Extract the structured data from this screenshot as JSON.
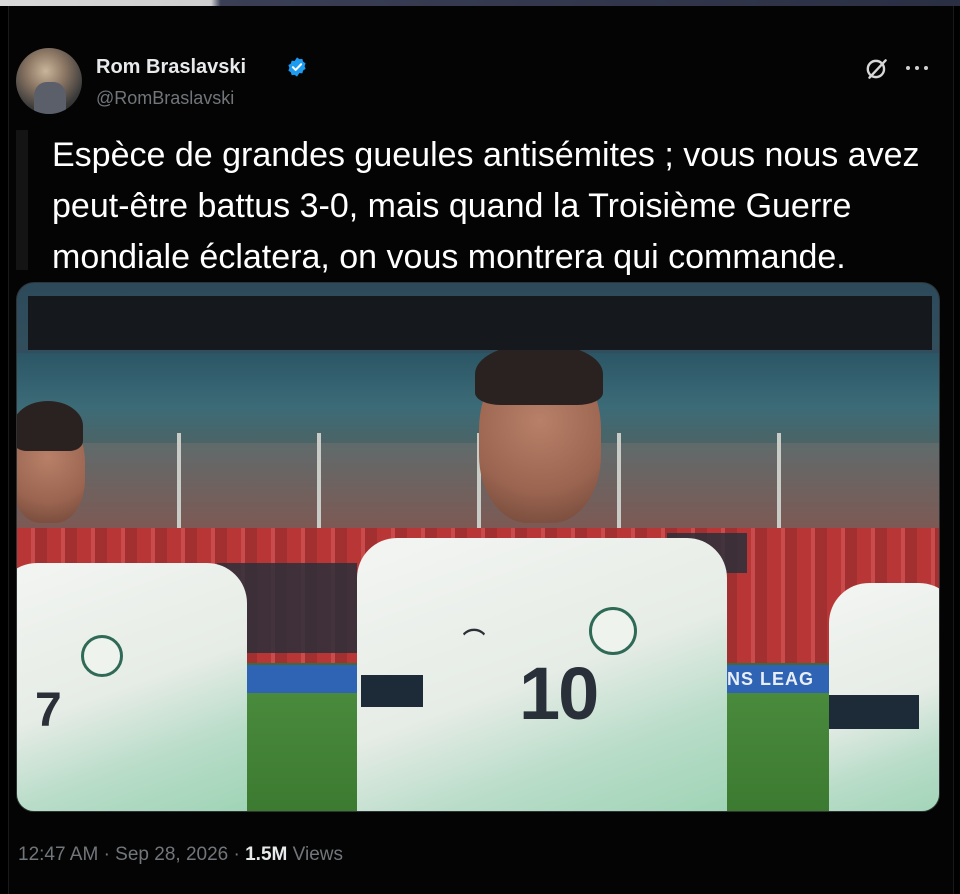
{
  "tweet": {
    "display_name": "Rom Braslavski",
    "handle": "@RomBraslavski",
    "verified": true,
    "text": "Espèce de grandes gueules antisémites ; vous nous avez peut-être battus 3-0, mais quand la Troisième Guerre mondiale éclatera, on vous montrera qui commande.",
    "time": "12:47 AM",
    "separator": "·",
    "date": "Sep 28, 2026",
    "views_count": "1.5M",
    "views_label": "Views"
  },
  "media": {
    "shirt_number": "10",
    "left_player_number": "7",
    "banner_text": "NS LEAG"
  },
  "icons": {
    "verified": "verified-badge-icon",
    "grok": "grok-icon",
    "more": "more-icon"
  },
  "colors": {
    "background": "#000000",
    "text": "#e7e9ea",
    "secondary_text": "#71767b",
    "verified_blue": "#1d9bf0"
  }
}
